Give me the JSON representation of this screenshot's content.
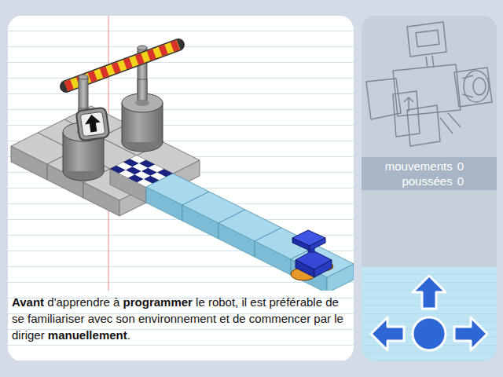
{
  "intro": [
    {
      "text": "Avant",
      "bold": true
    },
    {
      "text": " d'apprendre à ",
      "bold": false
    },
    {
      "text": "programmer",
      "bold": true
    },
    {
      "text": " le robot, il est préférable de se familiariser avec son environnement et de commencer par le diriger ",
      "bold": false
    },
    {
      "text": "manuellement",
      "bold": true
    },
    {
      "text": ".",
      "bold": false
    }
  ],
  "stats": [
    {
      "label": "mouvements",
      "value": "0"
    },
    {
      "label": "poussées",
      "value": "0"
    }
  ],
  "controls": [
    {
      "kind": "up"
    },
    {
      "kind": "left"
    },
    {
      "kind": "action"
    },
    {
      "kind": "right"
    }
  ]
}
